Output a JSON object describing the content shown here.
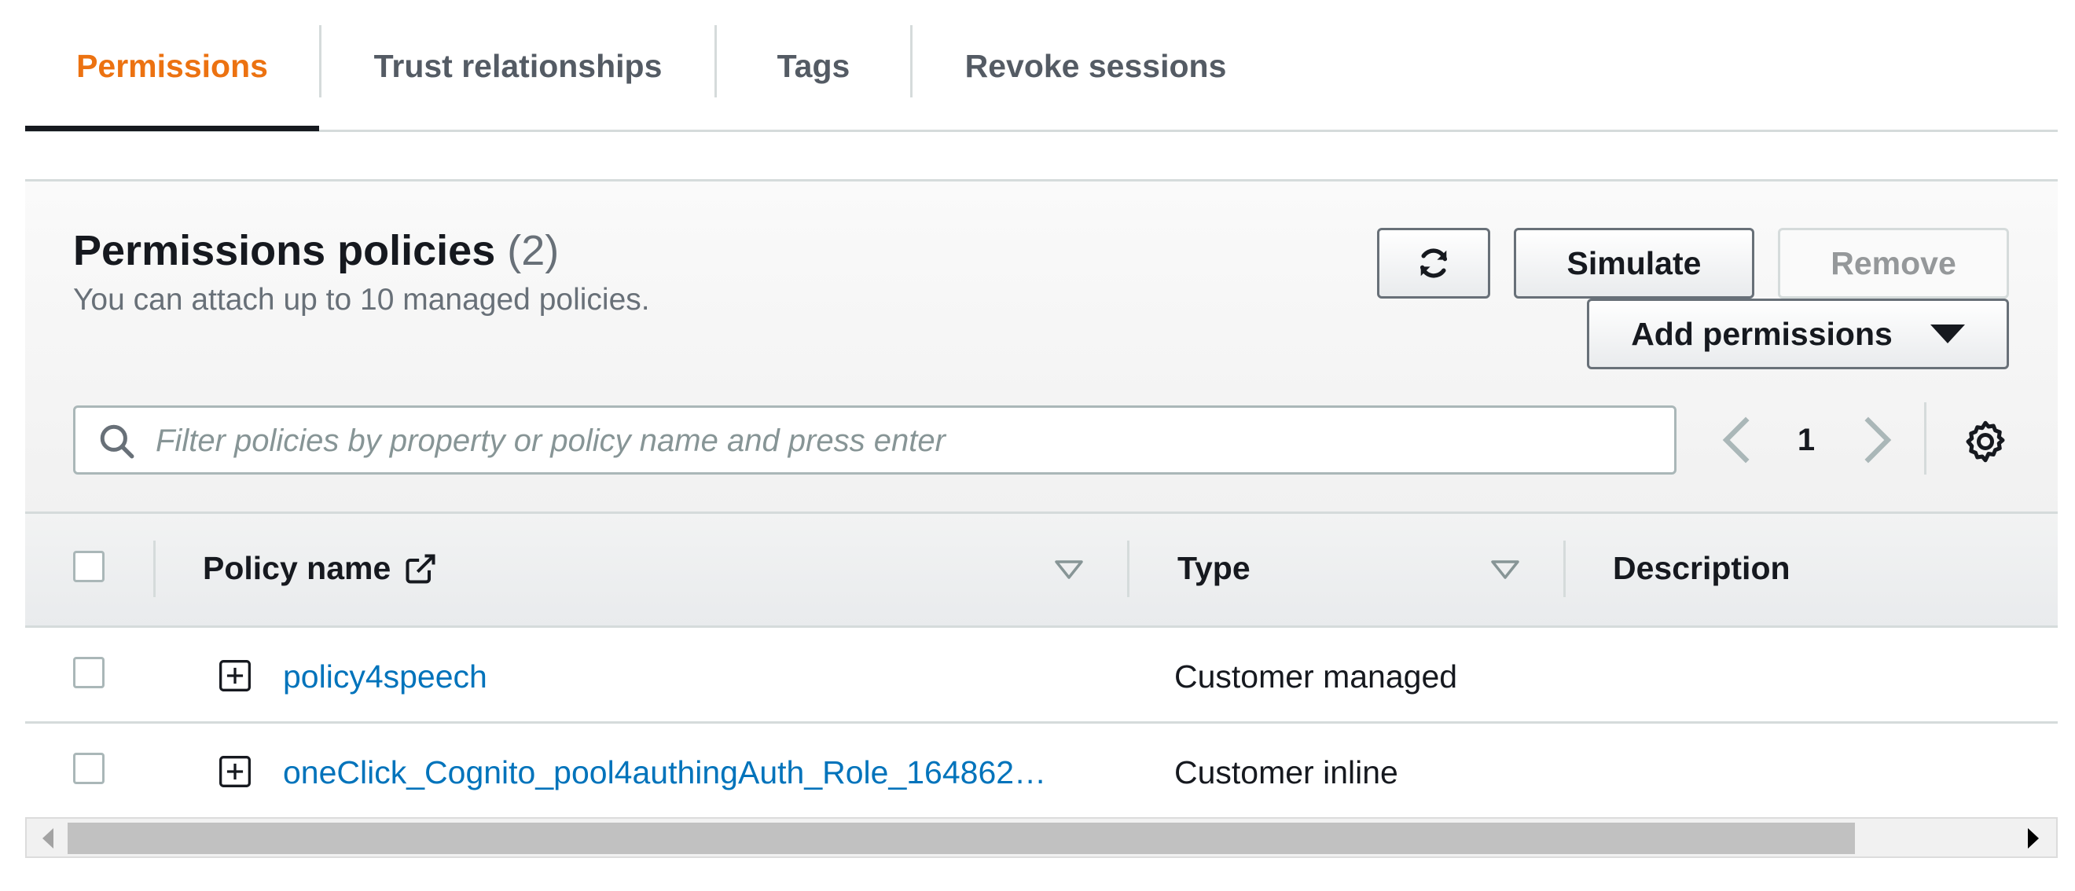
{
  "tabs": [
    {
      "label": "Permissions",
      "active": true
    },
    {
      "label": "Trust relationships",
      "active": false
    },
    {
      "label": "Tags",
      "active": false
    },
    {
      "label": "Revoke sessions",
      "active": false
    }
  ],
  "panel": {
    "title": "Permissions policies",
    "count": "(2)",
    "subtitle": "You can attach up to 10 managed policies.",
    "buttons": {
      "simulate": "Simulate",
      "remove": "Remove",
      "add_permissions": "Add permissions"
    },
    "search": {
      "placeholder": "Filter policies by property or policy name and press enter",
      "value": ""
    },
    "pagination": {
      "current_page": "1"
    }
  },
  "table": {
    "columns": {
      "policy_name": "Policy name",
      "type": "Type",
      "description": "Description"
    },
    "rows": [
      {
        "policy_name": "policy4speech",
        "type": "Customer managed",
        "description": ""
      },
      {
        "policy_name": "oneClick_Cognito_pool4authingAuth_Role_164862…",
        "type": "Customer inline",
        "description": ""
      }
    ]
  },
  "colors": {
    "active_tab": "#ec7211",
    "link": "#0073bb",
    "muted_text": "#687078"
  }
}
